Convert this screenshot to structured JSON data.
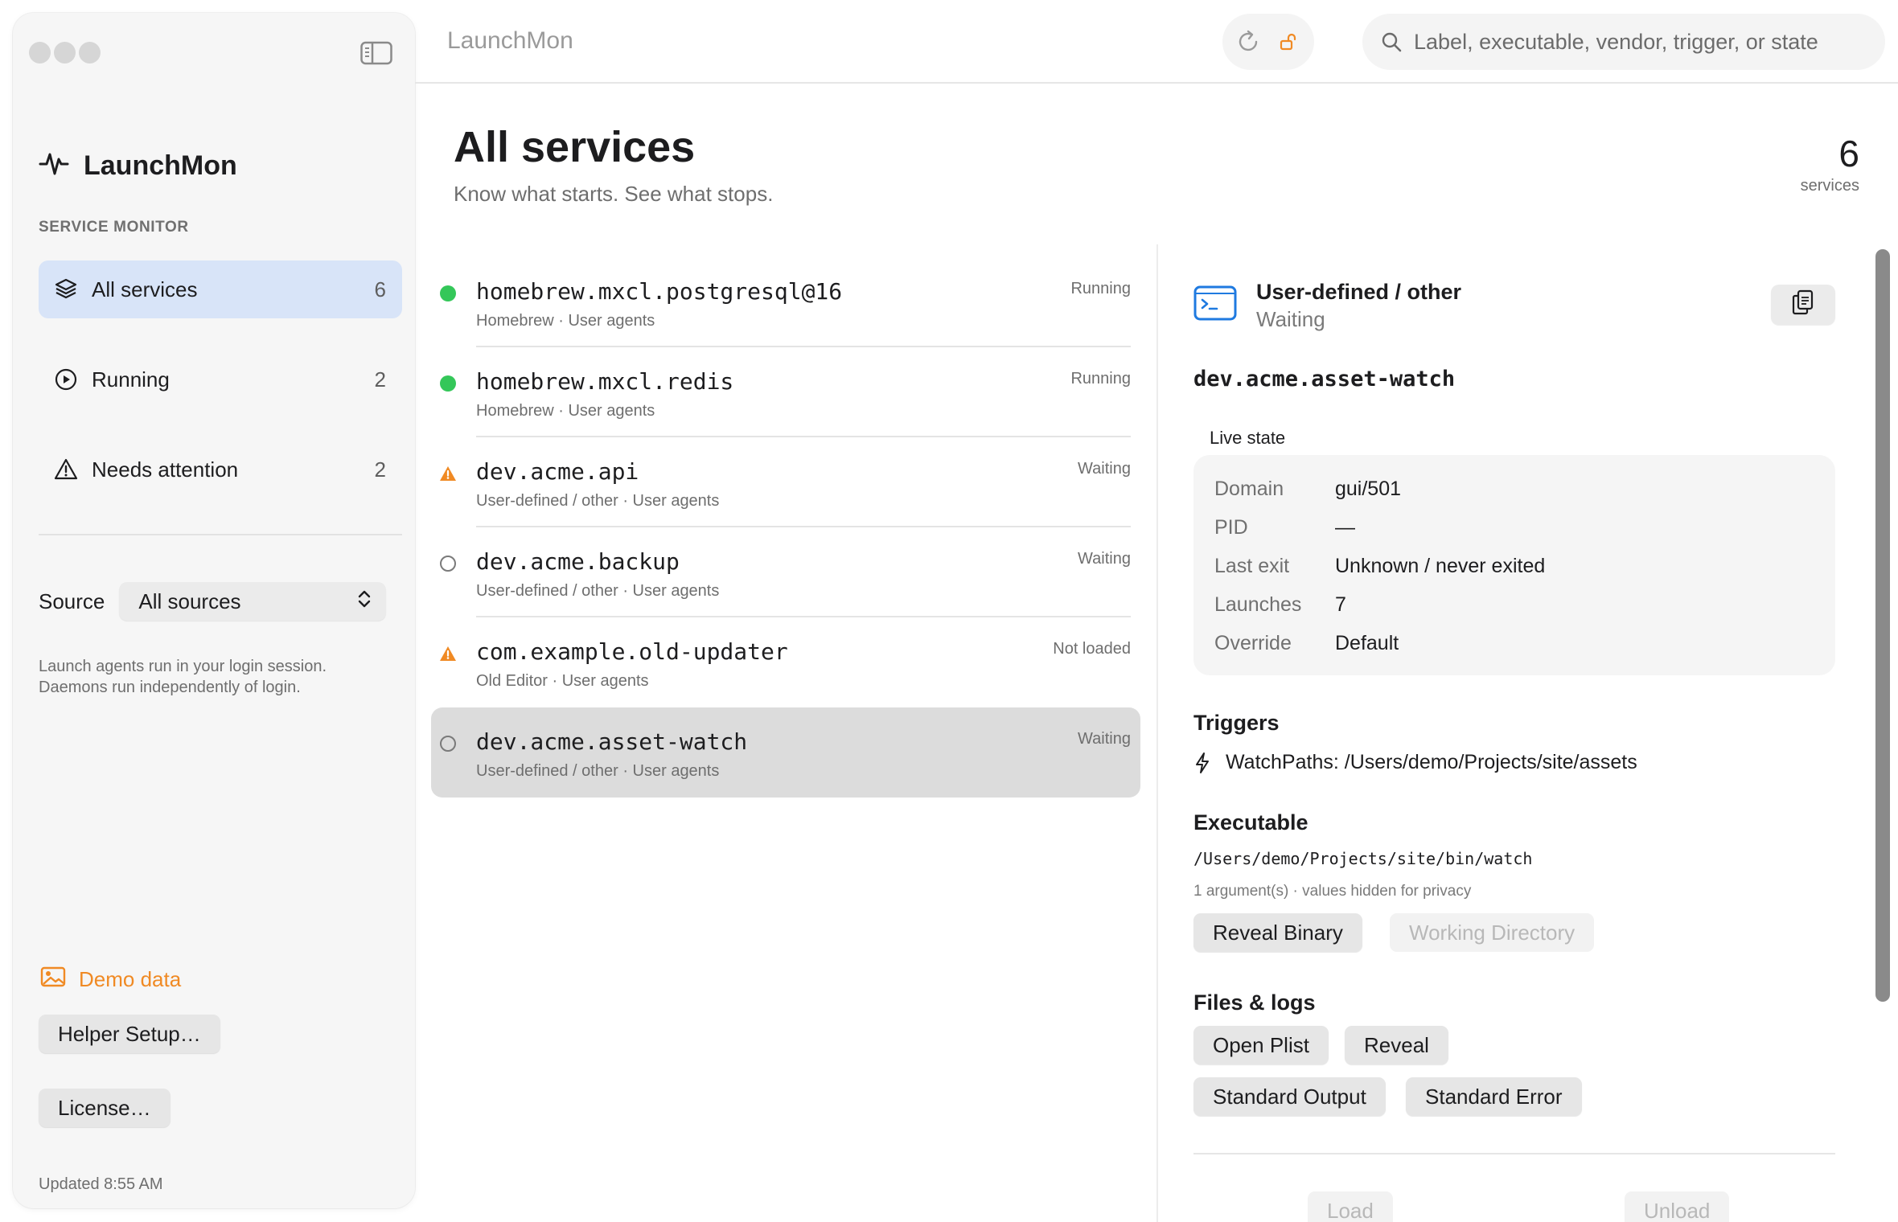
{
  "app": {
    "title": "LaunchMon",
    "brand_name": "LaunchMon",
    "section_label": "SERVICE MONITOR"
  },
  "sidebar": {
    "items": [
      {
        "label": "All services",
        "count": "6",
        "icon": "layers-icon",
        "active": true
      },
      {
        "label": "Running",
        "count": "2",
        "icon": "play-circle-icon",
        "active": false
      },
      {
        "label": "Needs attention",
        "count": "2",
        "icon": "warning-triangle-icon",
        "active": false
      }
    ],
    "source_label": "Source",
    "source_value": "All sources",
    "note": "Launch agents run in your login session. Daemons run independently of login.",
    "demo_label": "Demo data",
    "helper_button": "Helper Setup…",
    "license_button": "License…",
    "updated": "Updated 8:55 AM"
  },
  "search": {
    "placeholder": "Label, executable, vendor, trigger, or state"
  },
  "header": {
    "title": "All services",
    "subtitle": "Know what starts. See what stops.",
    "count": "6",
    "count_label": "services"
  },
  "services": [
    {
      "name": "homebrew.mxcl.postgresql@16",
      "meta": "Homebrew · User agents",
      "state": "Running",
      "status": "running"
    },
    {
      "name": "homebrew.mxcl.redis",
      "meta": "Homebrew · User agents",
      "state": "Running",
      "status": "running"
    },
    {
      "name": "dev.acme.api",
      "meta": "User-defined / other · User agents",
      "state": "Waiting",
      "status": "warning"
    },
    {
      "name": "dev.acme.backup",
      "meta": "User-defined / other · User agents",
      "state": "Waiting",
      "status": "idle"
    },
    {
      "name": "com.example.old-updater",
      "meta": "Old Editor · User agents",
      "state": "Not loaded",
      "status": "warning"
    },
    {
      "name": "dev.acme.asset-watch",
      "meta": "User-defined / other · User agents",
      "state": "Waiting",
      "status": "idle",
      "selected": true
    }
  ],
  "detail": {
    "kind": "User-defined / other",
    "state": "Waiting",
    "label": "dev.acme.asset-watch",
    "live_state_title": "Live state",
    "live_state": [
      {
        "key": "Domain",
        "value": "gui/501"
      },
      {
        "key": "PID",
        "value": "—"
      },
      {
        "key": "Last exit",
        "value": "Unknown / never exited"
      },
      {
        "key": "Launches",
        "value": "7"
      },
      {
        "key": "Override",
        "value": "Default"
      }
    ],
    "triggers_title": "Triggers",
    "trigger": "WatchPaths: /Users/demo/Projects/site/assets",
    "executable_title": "Executable",
    "executable_path": "/Users/demo/Projects/site/bin/watch",
    "executable_note": "1 argument(s) · values hidden for privacy",
    "reveal_binary": "Reveal Binary",
    "working_directory": "Working Directory",
    "files_title": "Files & logs",
    "open_plist": "Open Plist",
    "reveal": "Reveal",
    "standard_output": "Standard Output",
    "standard_error": "Standard Error",
    "load": "Load",
    "unload": "Unload"
  },
  "colors": {
    "accent_blue": "#d8e4f8",
    "running_green": "#34c759",
    "warning_orange": "#f08a24",
    "terminal_blue": "#1f7ae0"
  }
}
